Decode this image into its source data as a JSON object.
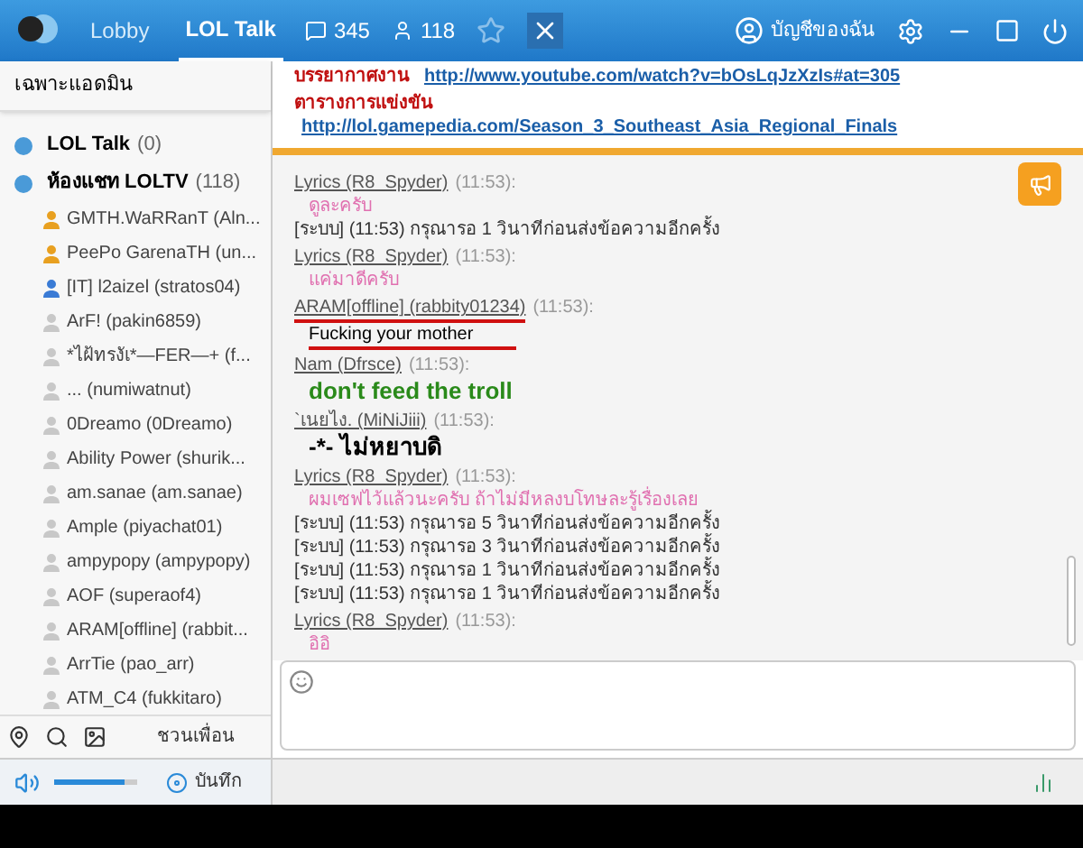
{
  "titlebar": {
    "tabs": [
      {
        "label": "Lobby",
        "selected": false
      },
      {
        "label": "LOL Talk",
        "selected": true
      }
    ],
    "message_count": "345",
    "member_count": "118",
    "favorite": false,
    "account": "บัญชีของฉัน"
  },
  "sidebar": {
    "header": "เฉพาะแอดมิน",
    "channels": [
      {
        "name": "LOL Talk",
        "count": "(0)"
      },
      {
        "name": "ห้องแชท LOLTV",
        "count": "(118)",
        "members": [
          {
            "name": "GMTH.WaRRanT (Aln...",
            "color": "#e8a020"
          },
          {
            "name": "PeePo GarenaTH (un...",
            "color": "#e8a020"
          },
          {
            "name": "[IT] l2aizel (stratos04)",
            "color": "#3a7bd5"
          },
          {
            "name": "ArF! (pakin6859)",
            "color": "#c8c8c8"
          },
          {
            "name": "*ไฝ้ทรงัเ*—FER—+ (f...",
            "color": "#c8c8c8"
          },
          {
            "name": "... (numiwatnut)",
            "color": "#c8c8c8"
          },
          {
            "name": "0Dreamo (0Dreamo)",
            "color": "#c8c8c8"
          },
          {
            "name": "Ability Power (shurik...",
            "color": "#c8c8c8"
          },
          {
            "name": "am.sanae (am.sanae)",
            "color": "#c8c8c8"
          },
          {
            "name": "Ample (piyachat01)",
            "color": "#c8c8c8"
          },
          {
            "name": "ampypopy (ampypopy)",
            "color": "#c8c8c8"
          },
          {
            "name": "AOF (superaof4)",
            "color": "#c8c8c8"
          },
          {
            "name": "ARAM[offline] (rabbit...",
            "color": "#c8c8c8"
          },
          {
            "name": "ArrTie (pao_arr)",
            "color": "#c8c8c8"
          },
          {
            "name": "ATM_C4 (fukkitaro)",
            "color": "#c8c8c8"
          }
        ]
      }
    ],
    "invite": "ชวนเพื่อน"
  },
  "announcement": [
    {
      "label": "บรรยากาศงาน",
      "link": "http://www.youtube.com/watch?v=bOsLqJzXzIs#at=305"
    },
    {
      "label": "ตารางการแข่งขัน",
      "link": "http://lol.gamepedia.com/Season_3_Southeast_Asia_Regional_Finals"
    }
  ],
  "messages": [
    {
      "kind": "user",
      "sender": "Lyrics (R8_Spyder)",
      "time": "(11:53):",
      "text": "ดูละครับ",
      "color": "#e070b0",
      "emphasis": false,
      "marked": false
    },
    {
      "kind": "system",
      "text": "[ระบบ] (11:53) กรุณารอ 1 วินาทีก่อนส่งข้อความอีกครั้ง"
    },
    {
      "kind": "user",
      "sender": "Lyrics (R8_Spyder)",
      "time": "(11:53):",
      "text": "แค่มาดีครับ",
      "color": "#e070b0",
      "emphasis": false,
      "marked": false
    },
    {
      "kind": "user",
      "sender": "ARAM[offline] (rabbity01234)",
      "time": "(11:53):",
      "text": "Fucking your mother",
      "color": "#000000",
      "emphasis": false,
      "marked": true
    },
    {
      "kind": "user",
      "sender": "Nam (Dfrsce)",
      "time": "(11:53):",
      "text": "don't feed the troll",
      "color": "#2a8a1a",
      "emphasis": true,
      "marked": false
    },
    {
      "kind": "user",
      "sender": "`เนยไง. (MiNiJiii)",
      "time": "(11:53):",
      "text": "-*- ไม่หยาบดิ",
      "color": "#000000",
      "emphasis": true,
      "marked": false
    },
    {
      "kind": "user",
      "sender": "Lyrics (R8_Spyder)",
      "time": "(11:53):",
      "text": "ผมเซฟไว้แล้วนะครับ ถ้าไม่มีหลงบโทษละรู้เรื่องเลย",
      "color": "#e070b0",
      "emphasis": false,
      "marked": false
    },
    {
      "kind": "system",
      "text": "[ระบบ] (11:53) กรุณารอ 5 วินาทีก่อนส่งข้อความอีกครั้ง"
    },
    {
      "kind": "system",
      "text": "[ระบบ] (11:53) กรุณารอ 3 วินาทีก่อนส่งข้อความอีกครั้ง"
    },
    {
      "kind": "system",
      "text": "[ระบบ] (11:53) กรุณารอ 1 วินาทีก่อนส่งข้อความอีกครั้ง"
    },
    {
      "kind": "system",
      "text": "[ระบบ] (11:53) กรุณารอ 1 วินาทีก่อนส่งข้อความอีกครั้ง"
    },
    {
      "kind": "user",
      "sender": "Lyrics (R8_Spyder)",
      "time": "(11:53):",
      "text": "อิอิ",
      "color": "#e070b0",
      "emphasis": false,
      "marked": false
    }
  ],
  "volume": {
    "level": 0.85
  },
  "record": "บันทึก"
}
